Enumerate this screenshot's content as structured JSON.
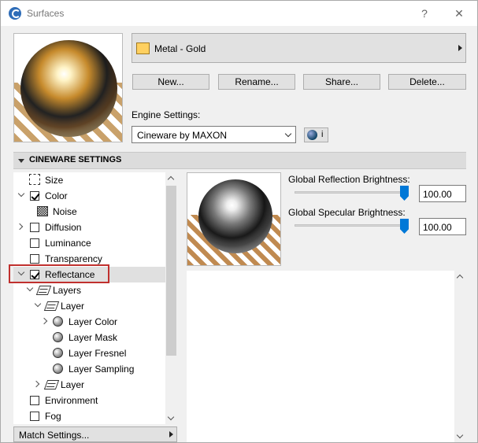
{
  "window": {
    "title": "Surfaces",
    "help_glyph": "?",
    "close_glyph": "✕",
    "app_icon": "archicad-logo-icon"
  },
  "material": {
    "name": "Metal - Gold",
    "swatch_color": "#ffd060"
  },
  "actions": {
    "new_label": "New...",
    "rename_label": "Rename...",
    "share_label": "Share...",
    "delete_label": "Delete..."
  },
  "engine": {
    "label": "Engine Settings:",
    "selected": "Cineware by MAXON",
    "info_glyph": "i"
  },
  "section": {
    "title": "CINEWARE SETTINGS"
  },
  "tree": {
    "items": [
      {
        "label": "Size"
      },
      {
        "label": "Color",
        "checked": true
      },
      {
        "label": "Noise"
      },
      {
        "label": "Diffusion",
        "checked": false
      },
      {
        "label": "Luminance",
        "checked": false
      },
      {
        "label": "Transparency",
        "checked": false
      },
      {
        "label": "Reflectance",
        "checked": true,
        "selected": true
      },
      {
        "label": "Layers"
      },
      {
        "label": "Layer"
      },
      {
        "label": "Layer Color"
      },
      {
        "label": "Layer Mask"
      },
      {
        "label": "Layer Fresnel"
      },
      {
        "label": "Layer Sampling"
      },
      {
        "label": "Layer"
      },
      {
        "label": "Environment",
        "checked": false
      },
      {
        "label": "Fog",
        "checked": false
      }
    ]
  },
  "match_settings": {
    "label": "Match Settings..."
  },
  "reflectance": {
    "reflection_label": "Global Reflection Brightness:",
    "reflection_value": "100.00",
    "reflection_level": 1.0,
    "specular_label": "Global Specular Brightness:",
    "specular_value": "100.00",
    "specular_level": 1.0
  },
  "colors": {
    "accent": "#0078d7",
    "highlight_box": "#c0302e"
  }
}
